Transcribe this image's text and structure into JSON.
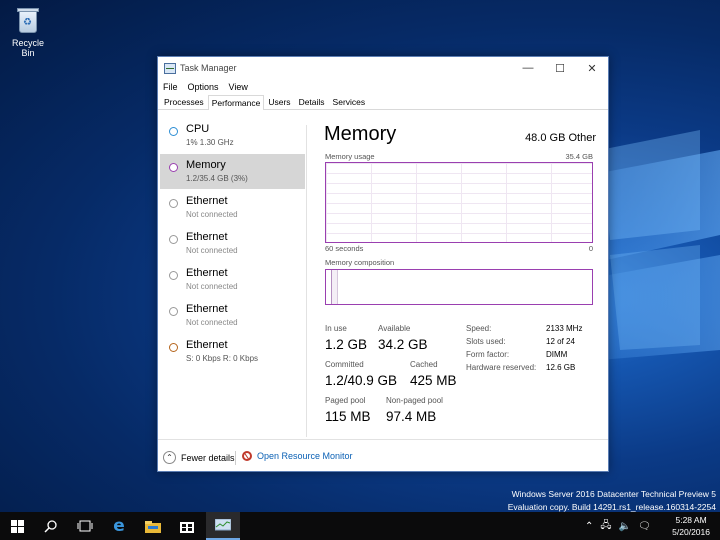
{
  "desktop": {
    "recycle_bin_label": "Recycle Bin",
    "watermark_line1": "Windows Server 2016 Datacenter Technical Preview 5",
    "watermark_line2": "Evaluation copy. Build 14291.rs1_release.160314-2254"
  },
  "window": {
    "title": "Task Manager",
    "menu": [
      "File",
      "Options",
      "View"
    ],
    "tabs": [
      "Processes",
      "Performance",
      "Users",
      "Details",
      "Services"
    ],
    "active_tab": "Performance"
  },
  "sidebar": {
    "items": [
      {
        "name": "CPU",
        "sub": "1% 1.30 GHz",
        "dot_color": "#2f8fd4"
      },
      {
        "name": "Memory",
        "sub": "1.2/35.4 GB (3%)",
        "dot_color": "#9a3fb0",
        "selected": true
      },
      {
        "name": "Ethernet",
        "sub": "Not connected",
        "dot_color": "#b9b9b9"
      },
      {
        "name": "Ethernet",
        "sub": "Not connected",
        "dot_color": "#b9b9b9"
      },
      {
        "name": "Ethernet",
        "sub": "Not connected",
        "dot_color": "#b9b9b9"
      },
      {
        "name": "Ethernet",
        "sub": "Not connected",
        "dot_color": "#b9b9b9"
      },
      {
        "name": "Ethernet",
        "sub": "S: 0 Kbps  R: 0 Kbps",
        "dot_color": "#b5651d"
      }
    ]
  },
  "memory": {
    "title": "Memory",
    "total_label": "48.0 GB Other",
    "usage_label": "Memory usage",
    "usage_max": "35.4 GB",
    "time_left": "60 seconds",
    "time_right": "0",
    "composition_label": "Memory composition",
    "in_use_label": "In use",
    "in_use_value": "1.2 GB",
    "available_label": "Available",
    "available_value": "34.2 GB",
    "committed_label": "Committed",
    "committed_value": "1.2/40.9 GB",
    "cached_label": "Cached",
    "cached_value": "425 MB",
    "paged_label": "Paged pool",
    "paged_value": "115 MB",
    "nonpaged_label": "Non-paged pool",
    "nonpaged_value": "97.4 MB",
    "specs": [
      {
        "label": "Speed:",
        "value": "2133 MHz"
      },
      {
        "label": "Slots used:",
        "value": "12 of 24"
      },
      {
        "label": "Form factor:",
        "value": "DIMM"
      },
      {
        "label": "Hardware reserved:",
        "value": "12.6 GB"
      }
    ]
  },
  "footer": {
    "fewer_details": "Fewer details",
    "open_resource_monitor": "Open Resource Monitor"
  },
  "taskbar": {
    "time": "5:28 AM",
    "date": "5/20/2016",
    "icons": [
      "start-icon",
      "search-icon",
      "task-view-icon",
      "edge-icon",
      "file-explorer-icon",
      "store-icon",
      "task-manager-icon"
    ]
  }
}
